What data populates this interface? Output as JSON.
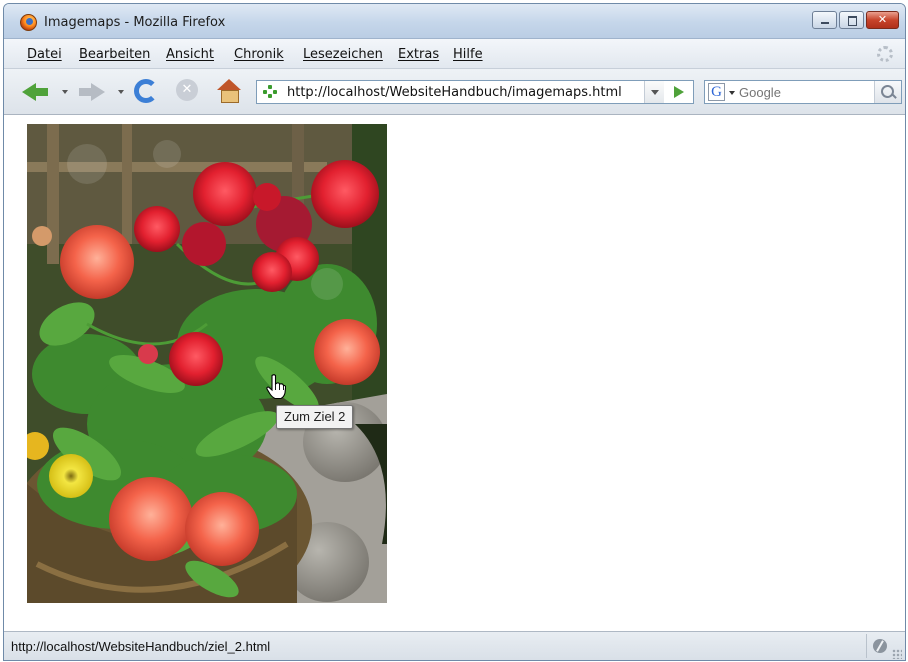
{
  "window": {
    "title": "Imagemaps - Mozilla Firefox",
    "icon": "firefox-icon",
    "controls": [
      "minimize-icon",
      "maximize-icon",
      "close-icon"
    ]
  },
  "menubar": {
    "items": [
      "Datei",
      "Bearbeiten",
      "Ansicht",
      "Chronik",
      "Lesezeichen",
      "Extras",
      "Hilfe"
    ]
  },
  "navbar": {
    "buttons": [
      "back-arrow-icon",
      "forward-arrow-icon",
      "reload-icon",
      "stop-icon",
      "home-icon"
    ],
    "url": "http://localhost/WebsiteHandbuch/imagemaps.html",
    "search": {
      "engine_letter": "G",
      "placeholder": "Google"
    }
  },
  "content": {
    "tooltip": "Zum Ziel 2"
  },
  "statusbar": {
    "text": "http://localhost/WebsiteHandbuch/ziel_2.html"
  },
  "colors": {
    "titlebar": "#c5d6ea",
    "accent_green": "#4fa23a",
    "flower_red": "#e8313e",
    "flower_orange": "#f26b4c"
  }
}
